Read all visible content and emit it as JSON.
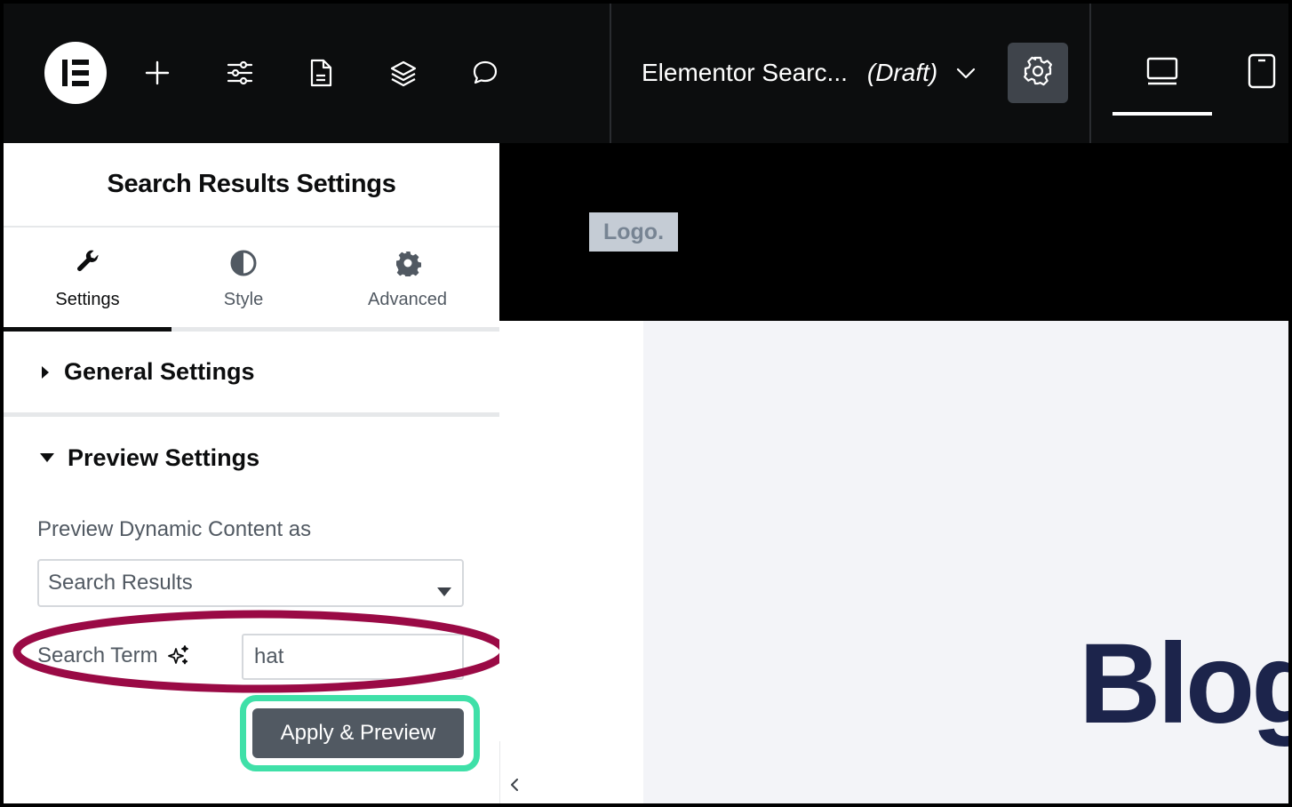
{
  "topbar": {
    "doc_name": "Elementor Searc...",
    "doc_status": "(Draft)",
    "icons": [
      "elementor-logo-icon",
      "add-icon",
      "site-settings-icon",
      "page-icon",
      "layers-icon",
      "comments-icon",
      "chevron-down-icon",
      "gear-icon",
      "desktop-icon",
      "tablet-icon"
    ]
  },
  "panel": {
    "title": "Search Results Settings",
    "tabs": [
      {
        "label": "Settings",
        "icon": "wrench-icon",
        "active": true
      },
      {
        "label": "Style",
        "icon": "contrast-icon",
        "active": false
      },
      {
        "label": "Advanced",
        "icon": "gear-icon",
        "active": false
      }
    ],
    "general_section": "General Settings",
    "preview_section": "Preview Settings",
    "preview_label": "Preview Dynamic Content as",
    "preview_select_value": "Search Results",
    "search_term_label": "Search Term",
    "search_term_value": "hat",
    "apply_button": "Apply & Preview"
  },
  "canvas": {
    "logo_text": "Logo.",
    "heading": "Blog"
  },
  "colors": {
    "topbar_bg": "#0c0d0e",
    "annotation_ellipse": "#9a0a45",
    "annotation_ring": "#3fe0a8",
    "heading": "#1c244b",
    "button_bg": "#515962"
  }
}
